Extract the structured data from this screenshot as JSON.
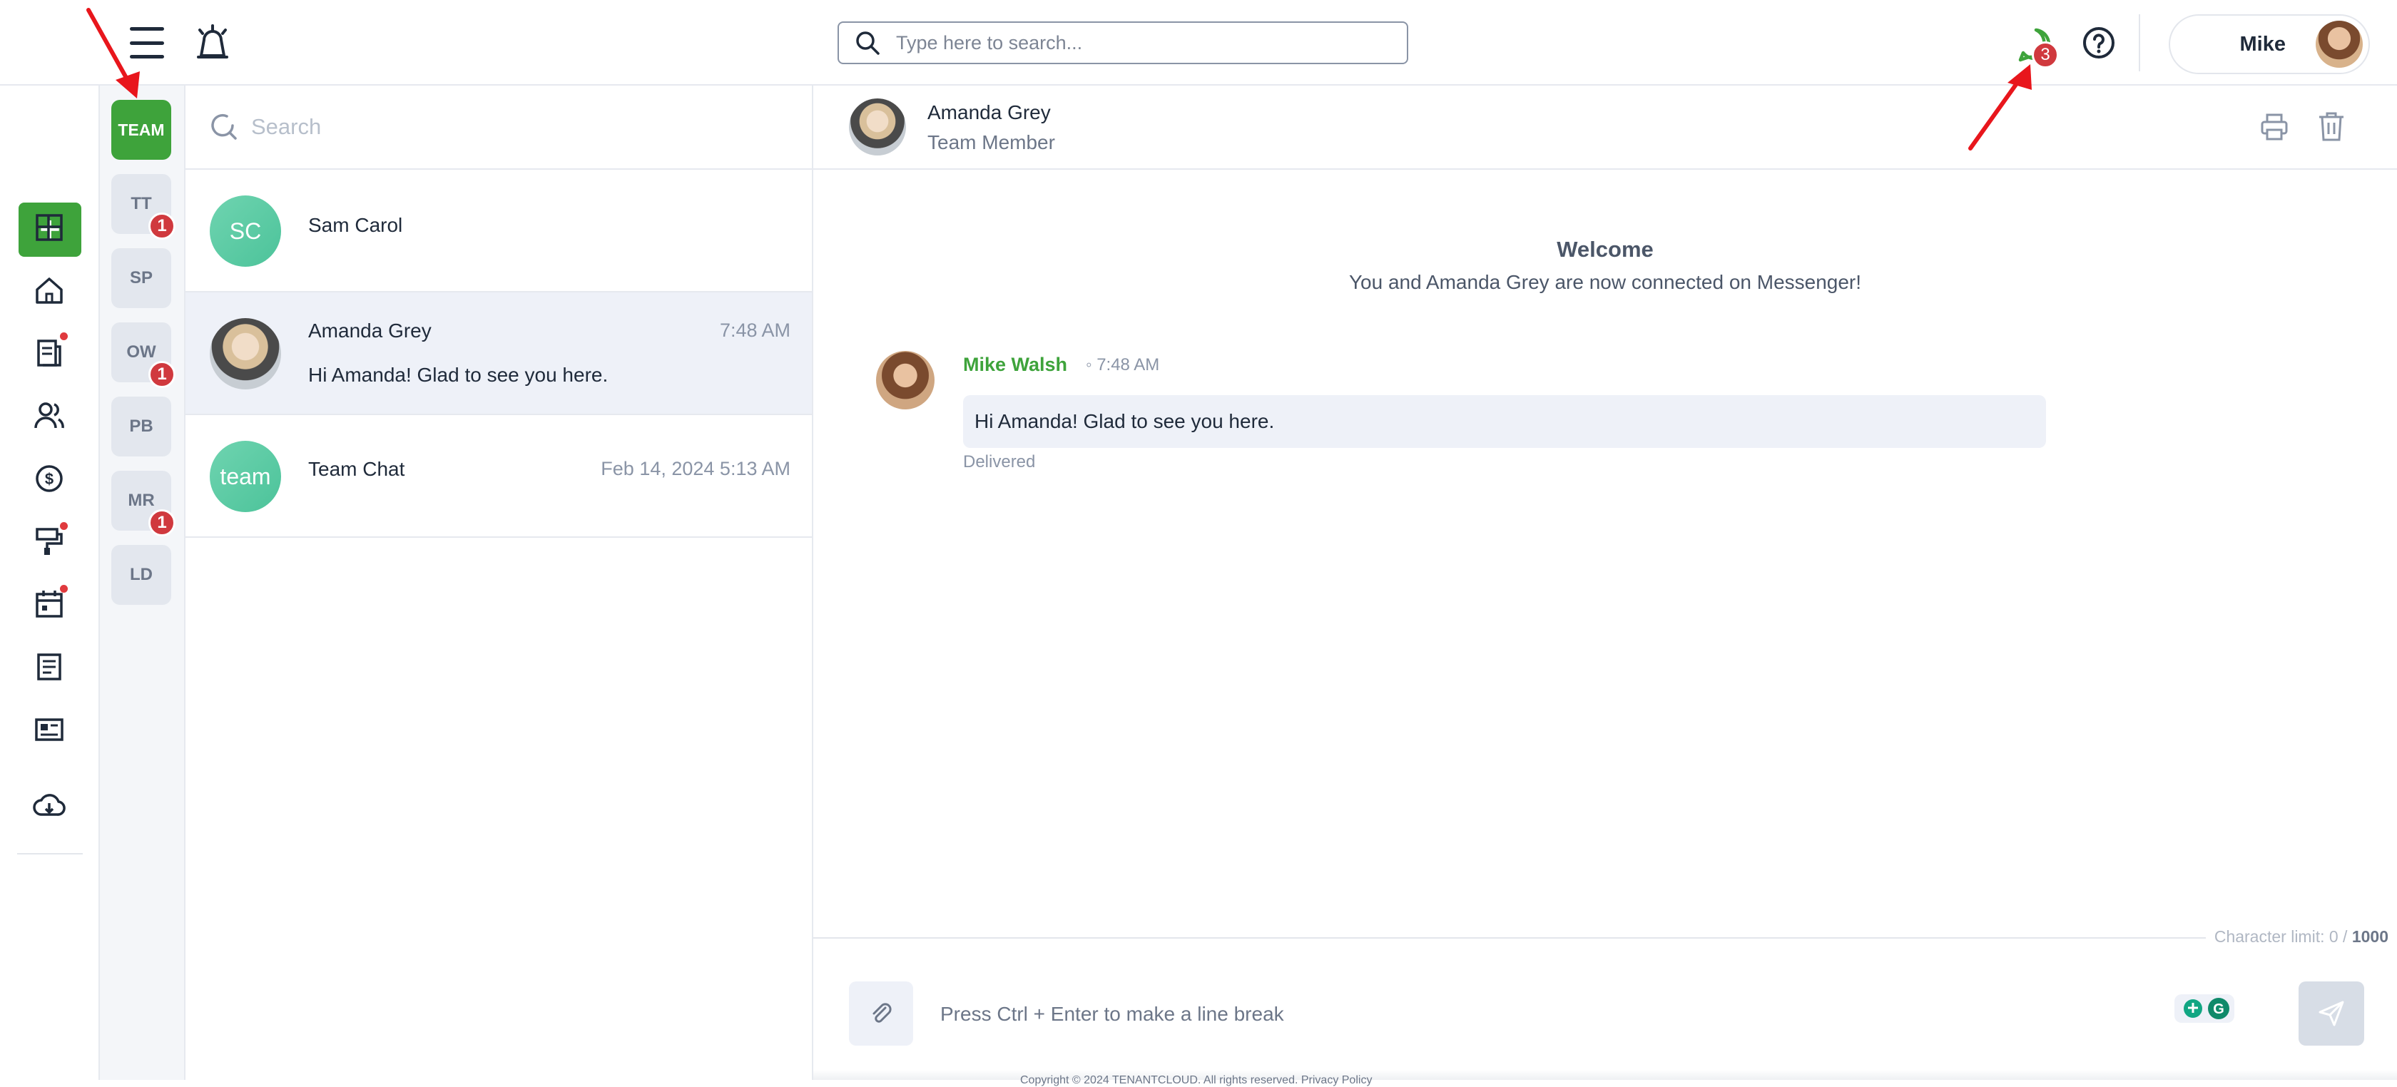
{
  "header": {
    "search_placeholder": "Type here to search...",
    "messages_badge": "3",
    "user_name": "Mike"
  },
  "teams": [
    {
      "label": "TEAM",
      "badge": ""
    },
    {
      "label": "TT",
      "badge": "1"
    },
    {
      "label": "SP",
      "badge": ""
    },
    {
      "label": "OW",
      "badge": "1"
    },
    {
      "label": "PB",
      "badge": ""
    },
    {
      "label": "MR",
      "badge": "1"
    },
    {
      "label": "LD",
      "badge": ""
    }
  ],
  "conversations": {
    "search_placeholder": "Search",
    "items": [
      {
        "initials": "SC",
        "name": "Sam Carol",
        "time": "",
        "preview": ""
      },
      {
        "initials": "",
        "name": "Amanda Grey",
        "time": "7:48 AM",
        "preview": "Hi Amanda! Glad to see you here."
      },
      {
        "initials": "team",
        "name": "Team Chat",
        "time": "Feb 14, 2024 5:13 AM",
        "preview": ""
      }
    ]
  },
  "chat": {
    "contact_name": "Amanda Grey",
    "contact_role": "Team Member",
    "welcome_title": "Welcome",
    "welcome_text": "You and Amanda Grey are now connected on Messenger!",
    "message": {
      "sender": "Mike Walsh",
      "time": "7:48 AM",
      "text": "Hi Amanda! Glad to see you here.",
      "status": "Delivered"
    },
    "char_limit_label": "Character limit: 0 / ",
    "char_limit_max": "1000",
    "compose_placeholder": "Press Ctrl + Enter to make a line break"
  },
  "footer": {
    "text": "Copyright © 2024 TENANTCLOUD. All rights reserved. Privacy Policy"
  },
  "colors": {
    "accent_green": "#3ea33b",
    "badge_red": "#d0393e",
    "annotation_red": "#e8161c"
  }
}
